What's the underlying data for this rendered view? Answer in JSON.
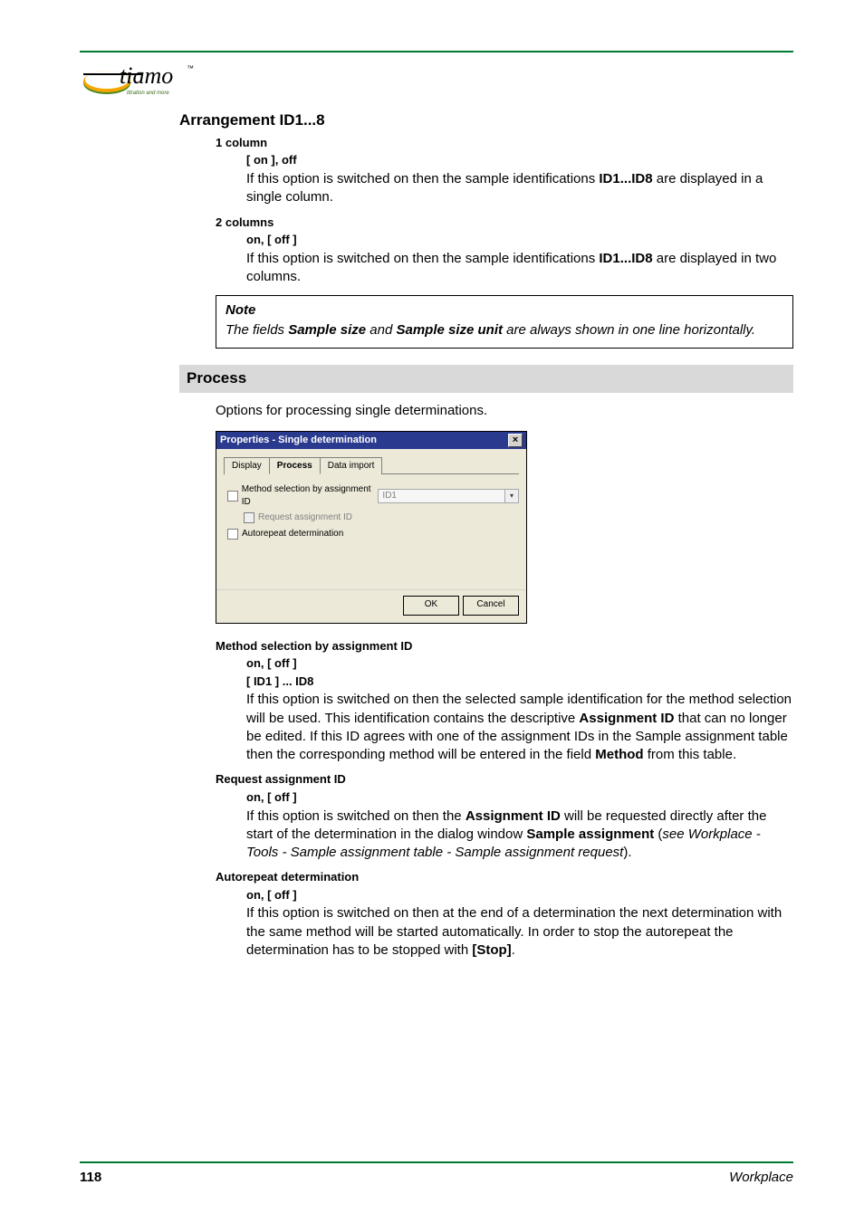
{
  "logo": {
    "brand_main": "tiamo",
    "brand_tm": "™",
    "tagline": "titration and more"
  },
  "arrangement": {
    "title": "Arrangement ID1...8",
    "opts": [
      {
        "name": "1 column",
        "state": "[ on ], off",
        "body_a": "If this option is switched on then the sample identifications ",
        "body_bold": "ID1...ID8",
        "body_b": " are displayed in a single column."
      },
      {
        "name": "2 columns",
        "state": "on, [ off ]",
        "body_a": "If this option is switched on then the sample identifications ",
        "body_bold": "ID1...ID8",
        "body_b": " are displayed in two columns."
      }
    ],
    "note": {
      "heading": "Note",
      "prefix": "The fields ",
      "b1": "Sample size",
      "mid": " and ",
      "b2": "Sample size unit",
      "suffix": " are always shown in one line horizontally."
    }
  },
  "process": {
    "bar": "Process",
    "intro": "Options for processing single determinations.",
    "dialog": {
      "title": "Properties - Single determination",
      "tabs": [
        "Display",
        "Process",
        "Data import"
      ],
      "chk1": "Method selection by assignment ID",
      "combo_value": "ID1",
      "chk2": "Request assignment ID",
      "chk3": "Autorepeat determination",
      "ok": "OK",
      "cancel": "Cancel"
    },
    "items": {
      "msel": {
        "name": "Method selection by assignment ID",
        "state": "on, [ off ]",
        "range": "[ ID1 ] ... ID8",
        "p1a": "If this option is switched on then the selected sample identification for the method selection will be used. This identification contains the descriptive ",
        "p1b": "Assignment ID",
        "p1c": " that can no longer be edited. If this ID agrees with one of the assignment IDs in the Sample assignment table then the corresponding method will be entered in the field ",
        "p1d": "Method",
        "p1e": " from this table."
      },
      "req": {
        "name": "Request assignment ID",
        "state": "on, [ off ]",
        "p1a": "If this option is switched on then the ",
        "p1b": "Assignment ID",
        "p1c": " will be requested directly after the start of the determination in the dialog window ",
        "p1d": "Sample assignment",
        "p1e": " (",
        "p1f": "see Workplace - Tools - Sample assignment table - Sample assignment request",
        "p1g": ")."
      },
      "auto": {
        "name": "Autorepeat determination",
        "state": "on, [ off ]",
        "p1a": "If this option is switched on then at the end of a determination the next determination with the same method will be started automatically. In order to stop the autorepeat the determination has to be stopped with ",
        "p1b": "[Stop]",
        "p1c": "."
      }
    }
  },
  "footer": {
    "page": "118",
    "section": "Workplace"
  }
}
